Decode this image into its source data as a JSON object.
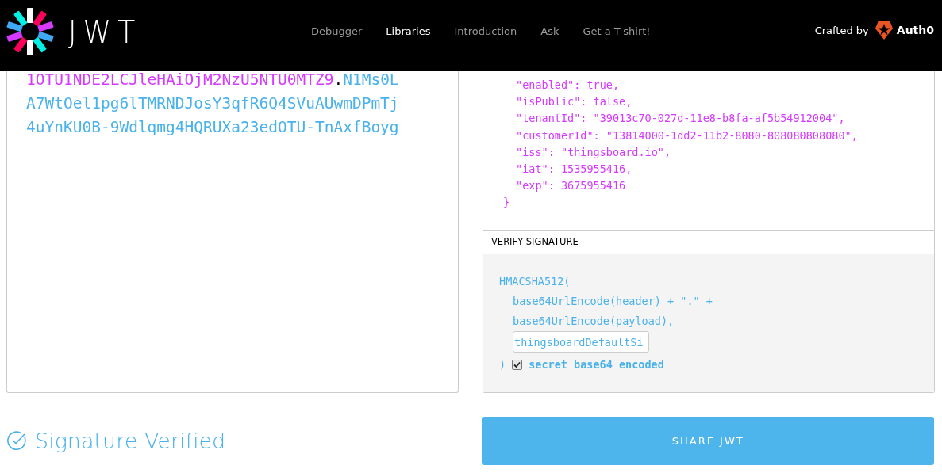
{
  "header": {
    "logo_text": "JWT",
    "nav": [
      {
        "label": "Debugger",
        "selected": false
      },
      {
        "label": "Libraries",
        "selected": true
      },
      {
        "label": "Introduction",
        "selected": false
      },
      {
        "label": "Ask",
        "selected": false
      },
      {
        "label": "Get a T-shirt!",
        "selected": false
      }
    ],
    "crafted_by": "Crafted by",
    "brand": "Auth0"
  },
  "encoded": {
    "lines": [
      [
        {
          "kind": "payload",
          "text": "1OTU1NDE2LCJleHAiOjM2NzU5NTU0MTZ9"
        },
        {
          "kind": "dot",
          "text": "."
        },
        {
          "kind": "signature",
          "text": "N1Ms0L"
        }
      ],
      [
        {
          "kind": "signature",
          "text": "A7WtOel1pg6lTMRNDJosY3qfR6Q4SVuAUwmDPmTj"
        }
      ],
      [
        {
          "kind": "signature",
          "text": "4uYnKU0B-9Wdlqmg4HQRUXa23edOTU-TnAxfBoyg"
        }
      ]
    ]
  },
  "payload": {
    "members": [
      "\"enabled\": true,",
      "\"isPublic\": false,",
      "\"tenantId\": \"39013c70-027d-11e8-b8fa-af5b54912004\",",
      "\"customerId\": \"13814000-1dd2-11b2-8080-808080808080\",",
      "\"iss\": \"thingsboard.io\",",
      "\"iat\": 1535955416,",
      "\"exp\": 3675955416"
    ],
    "closing": "}"
  },
  "verify_signature": {
    "title": "VERIFY SIGNATURE",
    "algorithm": "HMACSHA512(",
    "args": [
      "base64UrlEncode(header) + \".\" +",
      "base64UrlEncode(payload),"
    ],
    "secret": "thingsboardDefaultSi",
    "close": ")",
    "base64_encoded": {
      "label": "secret base64 encoded",
      "checked": true
    }
  },
  "status": "Signature Verified",
  "share_button": "SHARE JWT"
}
